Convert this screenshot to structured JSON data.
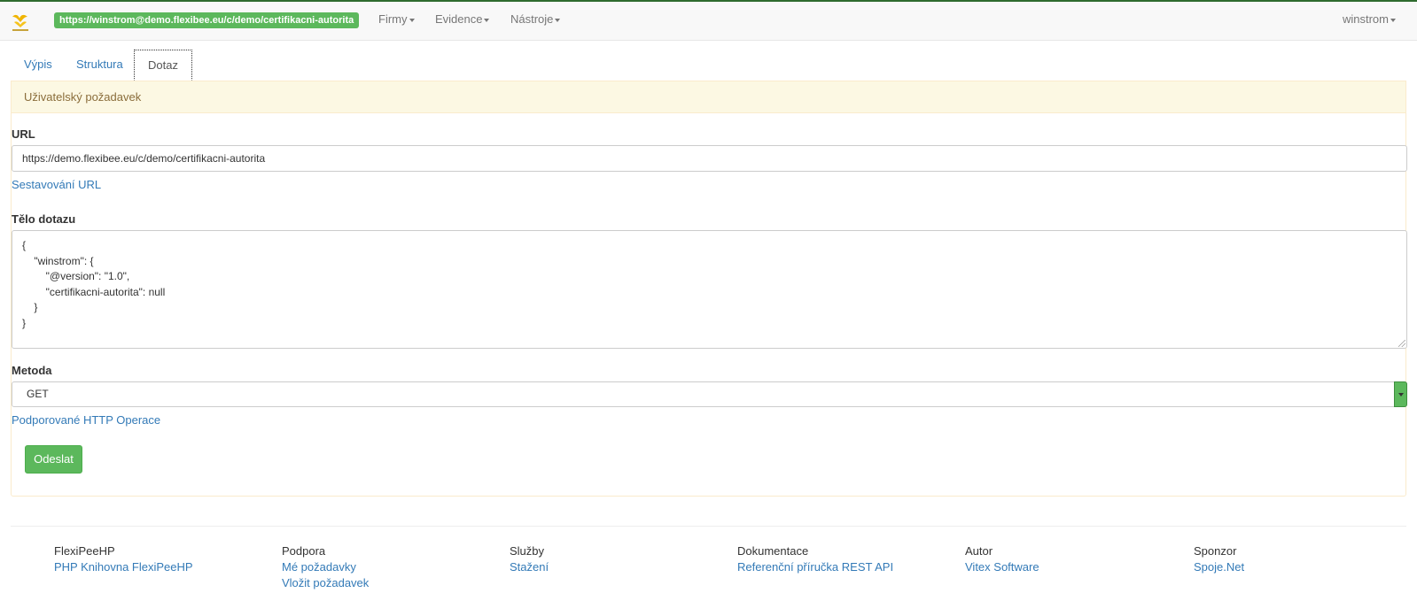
{
  "navbar": {
    "logo_icon": "flexipeehp-logo-icon",
    "url_badge": "https://winstrom@demo.flexibee.eu/c/demo/certifikacni-autorita",
    "menus": [
      "Firmy",
      "Evidence",
      "Nástroje"
    ],
    "user": "winstrom"
  },
  "tabs": [
    {
      "label": "Výpis"
    },
    {
      "label": "Struktura"
    },
    {
      "label": "Dotaz"
    }
  ],
  "panel": {
    "heading": "Uživatelský požadavek",
    "url_label": "URL",
    "url_value": "https://demo.flexibee.eu/c/demo/certifikacni-autorita",
    "url_help_link": "Sestavování URL",
    "body_label": "Tělo dotazu",
    "body_value": "{\n    \"winstrom\": {\n        \"@version\": \"1.0\",\n        \"certifikacni-autorita\": null\n    }\n}",
    "method_label": "Metoda",
    "method_value": "GET",
    "method_help_link": "Podporované HTTP Operace",
    "submit_label": "Odeslat"
  },
  "footer": {
    "columns": [
      {
        "heading": "FlexiPeeHP",
        "links": [
          "PHP Knihovna FlexiPeeHP"
        ]
      },
      {
        "heading": "Podpora",
        "links": [
          "Mé požadavky",
          "Vložit požadavek"
        ]
      },
      {
        "heading": "Služby",
        "links": [
          "Stažení"
        ]
      },
      {
        "heading": "Dokumentace",
        "links": [
          "Referenční příručka REST API"
        ]
      },
      {
        "heading": "Autor",
        "links": [
          "Vitex Software"
        ]
      },
      {
        "heading": "Sponzor",
        "links": [
          "Spoje.Net"
        ]
      }
    ]
  },
  "colors": {
    "accent_green": "#5cb85c",
    "link_blue": "#337ab7",
    "warning_bg": "#fcf8e3",
    "warning_text": "#8a6d3b"
  }
}
